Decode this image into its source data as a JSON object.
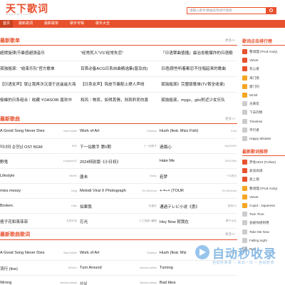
{
  "header": {
    "logo": "天下歌词",
    "logo_sub": "www.txgeci.com",
    "search_placeholder": "请输入歌手/歌曲名称进行搜索"
  },
  "nav": [
    {
      "label": "首页"
    },
    {
      "label": "最新歌词"
    },
    {
      "label": "最新歌单"
    },
    {
      "label": "歌手专辑"
    },
    {
      "label": "歌手大全"
    }
  ],
  "latest_playlists": {
    "title": "最新歌单",
    "more": "更多>>",
    "rows": [
      [
        "超燃旋律|节奏感超强音乐",
        "\"经常死人\"VS\"经常失恋\"",
        "「日语翠曲值撞」最治愈歌爆炸的日语歌"
      ],
      [
        "孤独摇滚：\"结束乐队\"官方歌单",
        "百首必备ACG日系自曲精选集(普及向)",
        "日语|那些听着都忍不住唱起来的歌曲"
      ],
      [
        "【日语女声】就让我再次沉溺于这遥遥大海",
        "【日系女声】钩皮节奏配上撩人声线",
        "孤独摇滚》完整版歌单(TV首全收录)"
      ],
      [
        "极蜂的日系组合｜收藏 YOASOBI 喜欢中",
        "和风｜物哀，如得其情，则哀矜而勿喜",
        "孤独摇滚，mygo，gbc附近少女乐队"
      ]
    ]
  },
  "latest_songs": {
    "title": "最新歌曲",
    "more": "更多>>",
    "rows": [
      [
        [
          "A Good Song Never Dies",
          "Saint Motel"
        ],
        [
          "Work of Art",
          "Shadow"
        ],
        [
          "Hush (feat. Mizz Fish)",
          "Knot"
        ]
      ],
      [
        [
          "미녀와 순정남 OST BGM",
          "KIKI"
        ],
        [
          "下一站歌手 第5期",
          "下一站歌手"
        ],
        [
          "過傷心",
          "MyGOHR"
        ]
      ],
      [
        [
          "野鬼",
          "LeopardXG"
        ],
        [
          "2024特别版《小日袄》",
          ""
        ],
        [
          "Hate Me",
          "DEVONN"
        ]
      ],
      [
        [
          "Lifestyle",
          "HMHK"
        ],
        [
          "唐未",
          "Tattoo"
        ],
        [
          "若梦",
          "一口袋文"
        ]
      ],
      [
        [
          "miss messy",
          "Ning"
        ],
        [
          "Melodi Viral X Photograph",
          "Ed Sheeran"
        ],
        [
          "+-=÷× (TOUR",
          "Ed Sheeran"
        ]
      ],
      [
        [
          "Broken.",
          "Hale"
        ],
        [
          "如果我",
          "任嘉伦"
        ],
        [
          "通過テレビ小说《勇》",
          "角色DJ"
        ]
      ],
      [
        [
          "痞子花和羡菲菲",
          "大花红花"
        ],
        [
          "忘光",
          "人工智能+编曲"
        ],
        [
          "Hey Now 就我在",
          "拳手乐队"
        ]
      ]
    ]
  },
  "latest_lyrics": {
    "title": "最新歌曲歌词",
    "more": "更多>>",
    "rows": [
      [
        [
          "A Good Song Never Dies",
          "Saint Motel"
        ],
        [
          "Work of Art",
          "Shadow"
        ],
        [
          "Hush (feat. Miz",
          "Knot"
        ]
      ],
      [
        [
          "流行 (live)",
          "MIYAVI"
        ],
        [
          "Turn Around",
          "Various Artists"
        ],
        [
          "Turning",
          ""
        ]
      ],
      [
        [
          "Wrong",
          "Various Artists"
        ],
        [
          "상실",
          "Various Artists"
        ],
        [
          "Bad Idea",
          ""
        ]
      ]
    ]
  },
  "sidebar": {
    "hot_title": "歌词点击排行榜",
    "hot": [
      "整调理 (Prod Andy)",
      "Velvet",
      "花心者",
      "海门南",
      "唐门的",
      "Mr.Mr",
      "天黄花",
      "下去的情",
      "Timeless",
      "平行者",
      "Happy Mistake"
    ],
    "rec_title": "最新歌词推荐",
    "rec": [
      "梦会2024 (Follow)",
      "爱浪高调",
      "爱上惚",
      "整调理 (Prod Andy)",
      "Velvet",
      "Cupid - Japanese",
      "Twin Time",
      "会被你想到用",
      "Take Me Now",
      "Falling night",
      "Run"
    ]
  },
  "watermark": {
    "title": "自动秒收录",
    "sub": "自动秒收录 ─ 来访一次 ─ 自动秒收"
  }
}
